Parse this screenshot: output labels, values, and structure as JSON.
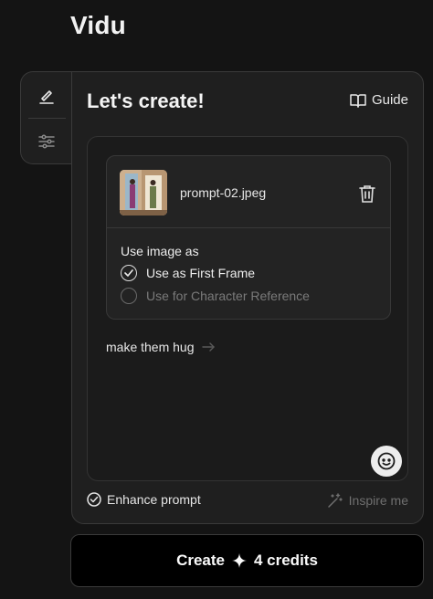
{
  "app": {
    "logo": "Vidu"
  },
  "rail": {
    "items": [
      {
        "icon": "pen-icon",
        "active": true
      },
      {
        "icon": "sliders-icon",
        "active": false
      }
    ]
  },
  "panel": {
    "title": "Let's create!",
    "guide_label": "Guide",
    "file": {
      "name": "prompt-02.jpeg"
    },
    "use_image": {
      "label": "Use image as",
      "options": [
        {
          "label": "Use as First Frame",
          "selected": true
        },
        {
          "label": "Use for Character Reference",
          "selected": false
        }
      ]
    },
    "prompt_text": "make them hug",
    "enhance_label": "Enhance prompt",
    "inspire_label": "Inspire me"
  },
  "create_button": {
    "label": "Create",
    "credits": "4 credits"
  },
  "colors": {
    "background": "#141414",
    "panel": "#1f1f1f",
    "muted_text": "#6f6f6f"
  }
}
